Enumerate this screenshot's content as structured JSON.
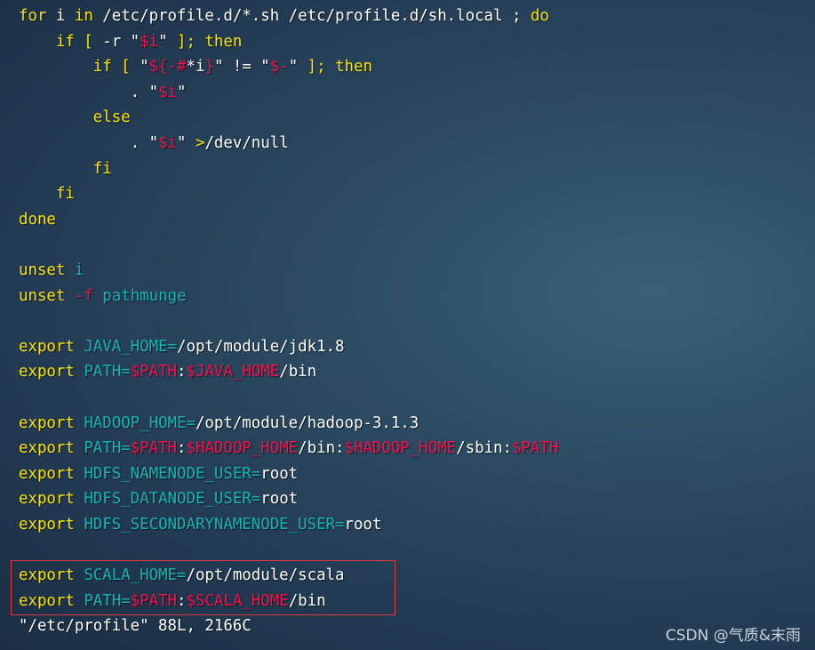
{
  "colors": {
    "keyword": "#f7e20e",
    "identifier": "#17b3b3",
    "special": "#f2124c",
    "text": "#ffffff",
    "highlight_box": "#e03a3a"
  },
  "editor": {
    "lines": [
      [
        {
          "t": "for",
          "c": "y"
        },
        {
          "t": " i ",
          "c": "w"
        },
        {
          "t": "in",
          "c": "y"
        },
        {
          "t": " /etc/profile.d/*.sh /etc/profile.d/sh.local ; ",
          "c": "w"
        },
        {
          "t": "do",
          "c": "y"
        }
      ],
      [
        {
          "t": "    ",
          "c": "w"
        },
        {
          "t": "if [",
          "c": "y"
        },
        {
          "t": " -r \"",
          "c": "w"
        },
        {
          "t": "$i",
          "c": "r"
        },
        {
          "t": "\" ",
          "c": "w"
        },
        {
          "t": "]; then",
          "c": "y"
        }
      ],
      [
        {
          "t": "        ",
          "c": "w"
        },
        {
          "t": "if [",
          "c": "y"
        },
        {
          "t": " \"",
          "c": "w"
        },
        {
          "t": "${-#",
          "c": "r"
        },
        {
          "t": "*i",
          "c": "w"
        },
        {
          "t": "}",
          "c": "r"
        },
        {
          "t": "\" != \"",
          "c": "w"
        },
        {
          "t": "$-",
          "c": "r"
        },
        {
          "t": "\" ",
          "c": "w"
        },
        {
          "t": "]; then",
          "c": "y"
        }
      ],
      [
        {
          "t": "            . \"",
          "c": "w"
        },
        {
          "t": "$i",
          "c": "r"
        },
        {
          "t": "\"",
          "c": "w"
        }
      ],
      [
        {
          "t": "        ",
          "c": "w"
        },
        {
          "t": "else",
          "c": "y"
        }
      ],
      [
        {
          "t": "            . \"",
          "c": "w"
        },
        {
          "t": "$i",
          "c": "r"
        },
        {
          "t": "\" ",
          "c": "w"
        },
        {
          "t": ">",
          "c": "y"
        },
        {
          "t": "/dev/null",
          "c": "w"
        }
      ],
      [
        {
          "t": "        ",
          "c": "w"
        },
        {
          "t": "fi",
          "c": "y"
        }
      ],
      [
        {
          "t": "    ",
          "c": "w"
        },
        {
          "t": "fi",
          "c": "y"
        }
      ],
      [
        {
          "t": "done",
          "c": "y"
        }
      ],
      [],
      [
        {
          "t": "unset",
          "c": "y"
        },
        {
          "t": " ",
          "c": "w"
        },
        {
          "t": "i",
          "c": "c"
        }
      ],
      [
        {
          "t": "unset",
          "c": "y"
        },
        {
          "t": " ",
          "c": "w"
        },
        {
          "t": "-f",
          "c": "r"
        },
        {
          "t": " ",
          "c": "w"
        },
        {
          "t": "pathmunge",
          "c": "c"
        }
      ],
      [],
      [
        {
          "t": "export",
          "c": "y"
        },
        {
          "t": " ",
          "c": "w"
        },
        {
          "t": "JAVA_HOME=",
          "c": "c"
        },
        {
          "t": "/opt/module/jdk1.8",
          "c": "w"
        }
      ],
      [
        {
          "t": "export",
          "c": "y"
        },
        {
          "t": " ",
          "c": "w"
        },
        {
          "t": "PATH=",
          "c": "c"
        },
        {
          "t": "$PATH",
          "c": "r"
        },
        {
          "t": ":",
          "c": "w"
        },
        {
          "t": "$JAVA_HOME",
          "c": "r"
        },
        {
          "t": "/bin",
          "c": "w"
        }
      ],
      [],
      [
        {
          "t": "export",
          "c": "y"
        },
        {
          "t": " ",
          "c": "w"
        },
        {
          "t": "HADOOP_HOME=",
          "c": "c"
        },
        {
          "t": "/opt/module/hadoop-3.1.3",
          "c": "w"
        }
      ],
      [
        {
          "t": "export",
          "c": "y"
        },
        {
          "t": " ",
          "c": "w"
        },
        {
          "t": "PATH=",
          "c": "c"
        },
        {
          "t": "$PATH",
          "c": "r"
        },
        {
          "t": ":",
          "c": "w"
        },
        {
          "t": "$HADOOP_HOME",
          "c": "r"
        },
        {
          "t": "/bin:",
          "c": "w"
        },
        {
          "t": "$HADOOP_HOME",
          "c": "r"
        },
        {
          "t": "/sbin:",
          "c": "w"
        },
        {
          "t": "$PATH",
          "c": "r"
        }
      ],
      [
        {
          "t": "export",
          "c": "y"
        },
        {
          "t": " ",
          "c": "w"
        },
        {
          "t": "HDFS_NAMENODE_USER=",
          "c": "c"
        },
        {
          "t": "root",
          "c": "w"
        }
      ],
      [
        {
          "t": "export",
          "c": "y"
        },
        {
          "t": " ",
          "c": "w"
        },
        {
          "t": "HDFS_DATANODE_USER=",
          "c": "c"
        },
        {
          "t": "root",
          "c": "w"
        }
      ],
      [
        {
          "t": "export",
          "c": "y"
        },
        {
          "t": " ",
          "c": "w"
        },
        {
          "t": "HDFS_SECONDARYNAMENODE_USER=",
          "c": "c"
        },
        {
          "t": "root",
          "c": "w"
        }
      ],
      [],
      [
        {
          "t": "export",
          "c": "y"
        },
        {
          "t": " ",
          "c": "w"
        },
        {
          "t": "SCALA_HOME=",
          "c": "c"
        },
        {
          "t": "/opt/module/scala",
          "c": "w"
        }
      ],
      [
        {
          "t": "export",
          "c": "y"
        },
        {
          "t": " ",
          "c": "w"
        },
        {
          "t": "PATH=",
          "c": "c"
        },
        {
          "t": "$PATH",
          "c": "r"
        },
        {
          "t": ":",
          "c": "w"
        },
        {
          "t": "$SCALA_HOME",
          "c": "r"
        },
        {
          "t": "/bin",
          "c": "w"
        }
      ]
    ],
    "status_line": "\"/etc/profile\" 88L, 2166C"
  },
  "watermark": "CSDN @气质&末雨"
}
